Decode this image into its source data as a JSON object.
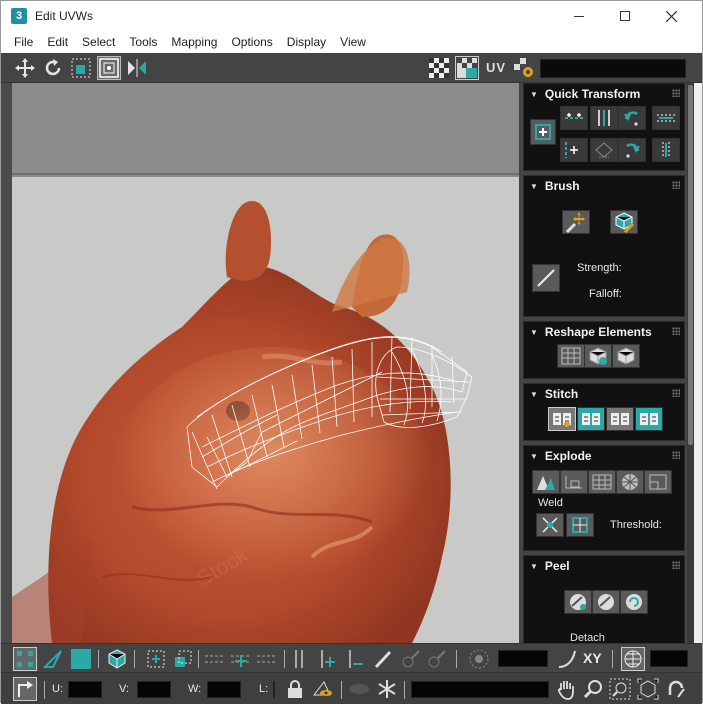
{
  "window": {
    "title": "Edit UVWs",
    "app_icon_text": "3",
    "controls": [
      "minimize-icon",
      "maximize-icon",
      "close-icon"
    ]
  },
  "menu": [
    "File",
    "Edit",
    "Select",
    "Tools",
    "Mapping",
    "Options",
    "Display",
    "View"
  ],
  "toolbar": {
    "left_icons": [
      "move-icon",
      "rotate-icon",
      "scale-icon",
      "freeform-icon",
      "mirror-icon"
    ],
    "right_icons": [
      "checker-pattern-icon",
      "checker-map-icon",
      "settings-icon"
    ],
    "uv_label": "UV",
    "map_dropdown_value": ""
  },
  "panels": {
    "quick_transform": {
      "title": "Quick Transform"
    },
    "brush": {
      "title": "Brush",
      "strength_label": "Strength:",
      "falloff_label": "Falloff:"
    },
    "reshape": {
      "title": "Reshape Elements"
    },
    "stitch": {
      "title": "Stitch"
    },
    "explode": {
      "title": "Explode",
      "weld_label": "Weld",
      "threshold_label": "Threshold:"
    },
    "peel": {
      "title": "Peel",
      "detach_label": "Detach"
    }
  },
  "status": {
    "u_label": "U:",
    "v_label": "V:",
    "w_label": "W:",
    "l_label": "L:",
    "u_value": "",
    "v_value": "",
    "w_value": "",
    "l_value": "",
    "xy_label": "XY"
  },
  "colors": {
    "accent_teal": "#2aa9a6",
    "panel_bg": "#111111",
    "toolbar_bg": "#444444"
  }
}
